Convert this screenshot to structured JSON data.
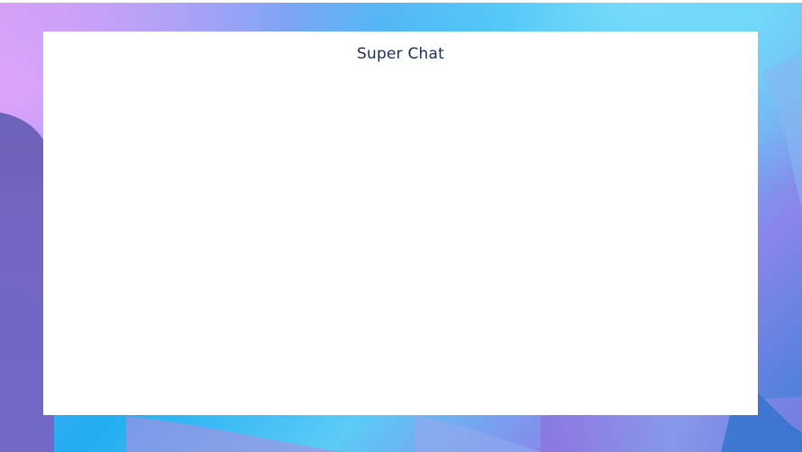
{
  "app": {
    "title": "Super Chat"
  },
  "colors": {
    "title_text": "#1b2e52",
    "window_background": "#ffffff",
    "wallpaper_accent_blue": "#21aef2",
    "wallpaper_accent_purple": "#8a86ea",
    "wallpaper_accent_pink": "#c99cf5"
  }
}
